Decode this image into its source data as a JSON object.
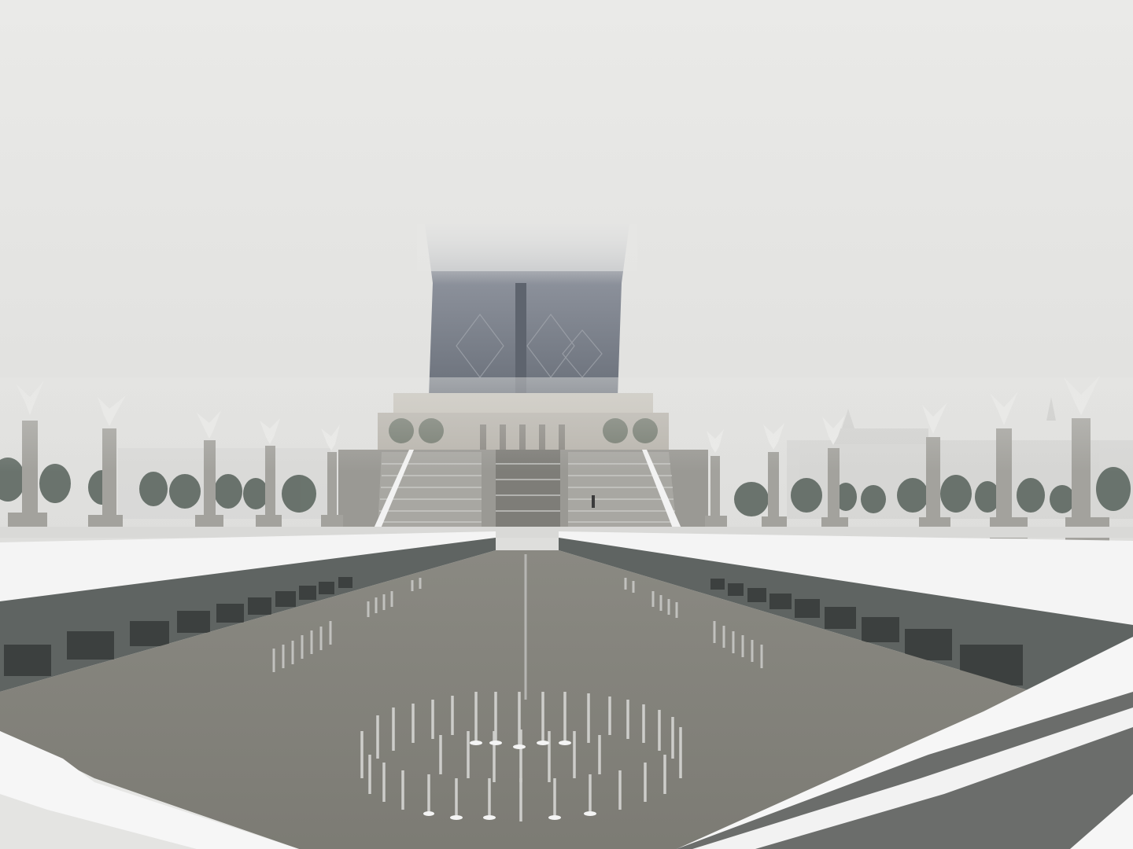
{
  "scene": {
    "subject": "snowy-plaza-with-fountain-pool",
    "colors": {
      "sky": "#e8e8e6",
      "fog": "#dcdcda",
      "tower": "#7b818b",
      "tower_dark": "#5c626c",
      "snow": "#f6f6f6",
      "pool_water": "#84837c",
      "pool_wall": "#5d6260",
      "stone": "#a9a8a3",
      "trees": "#4f5a50",
      "nozzle": "#b9b9b6"
    }
  }
}
